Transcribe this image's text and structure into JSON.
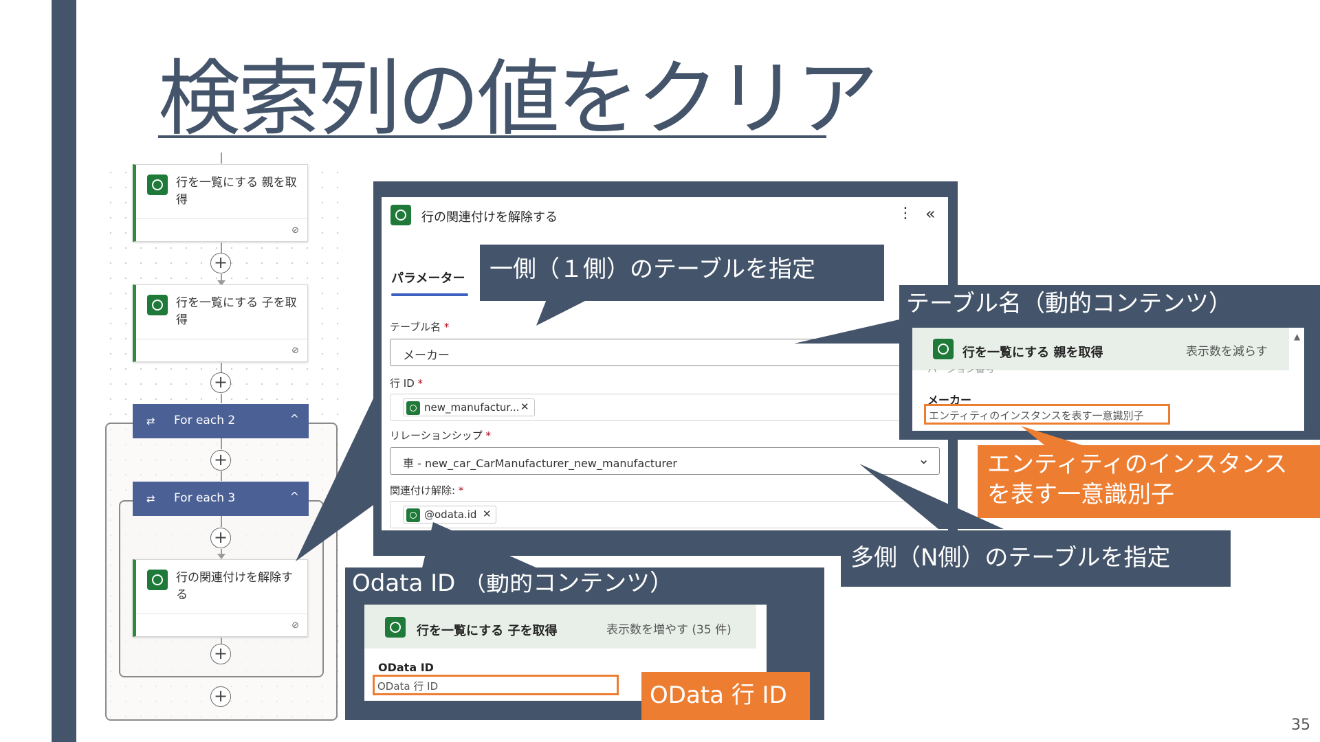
{
  "slide": {
    "title": "検索列の値をクリア",
    "page_number": "35"
  },
  "flow": {
    "card1": {
      "title": "行を一覧にする 親を取得"
    },
    "card2": {
      "title": "行を一覧にする 子を取得"
    },
    "foreach2": {
      "label": "For each 2"
    },
    "foreach3": {
      "label": "For each 3"
    },
    "card3": {
      "title": "行の関連付けを解除する"
    },
    "add_symbol": "+",
    "link_glyph": "⊘",
    "loop_glyph": "⇄",
    "chevron_up": "^"
  },
  "panel": {
    "title": "行の関連付けを解除する",
    "more_glyph": "⋮",
    "collapse_glyph": "«",
    "tab_parameters": "パラメーター",
    "table_name_label": "テーブル名",
    "table_name_value": "メーカー",
    "row_id_label": "行 ID",
    "row_id_token": "new_manufactur...",
    "relationship_label": "リレーションシップ",
    "relationship_value": "車 - new_car_CarManufacturer_new_manufacturer",
    "disassociate_label": "関連付け解除:",
    "disassociate_token": "@odata.id",
    "required_mark": "*",
    "remove_glyph": "✕",
    "dropdown_glyph": "⌄"
  },
  "callouts": {
    "one_side": "一側（１側）のテーブルを指定",
    "table_name_dynamic": "テーブル名（動的コンテンツ）",
    "entity_id_line1": "エンティティのインスタンス",
    "entity_id_line2": "を表す一意識別子",
    "many_side": "多側（N側）のテーブルを指定",
    "odata_id_dynamic": "Odata ID （動的コンテンツ）",
    "odata_row_id": "OData 行 ID"
  },
  "inset_parent": {
    "title": "行を一覧にする 親を取得",
    "action": "表示数を減らす",
    "faded_text": "バージョン番号",
    "item_label": "メーカー",
    "item_desc": "エンティティのインスタンスを表す一意識別子"
  },
  "inset_child": {
    "title": "行を一覧にする 子を取得",
    "action": "表示数を増やす (35 件)",
    "item_label": "OData ID",
    "item_desc": "OData 行 ID"
  },
  "colors": {
    "slate": "#44546a",
    "orange": "#ed7d31",
    "flow_blue": "#4b6196",
    "dataverse_green": "#1f7a3a",
    "tab_underline": "#3b5fc0"
  }
}
